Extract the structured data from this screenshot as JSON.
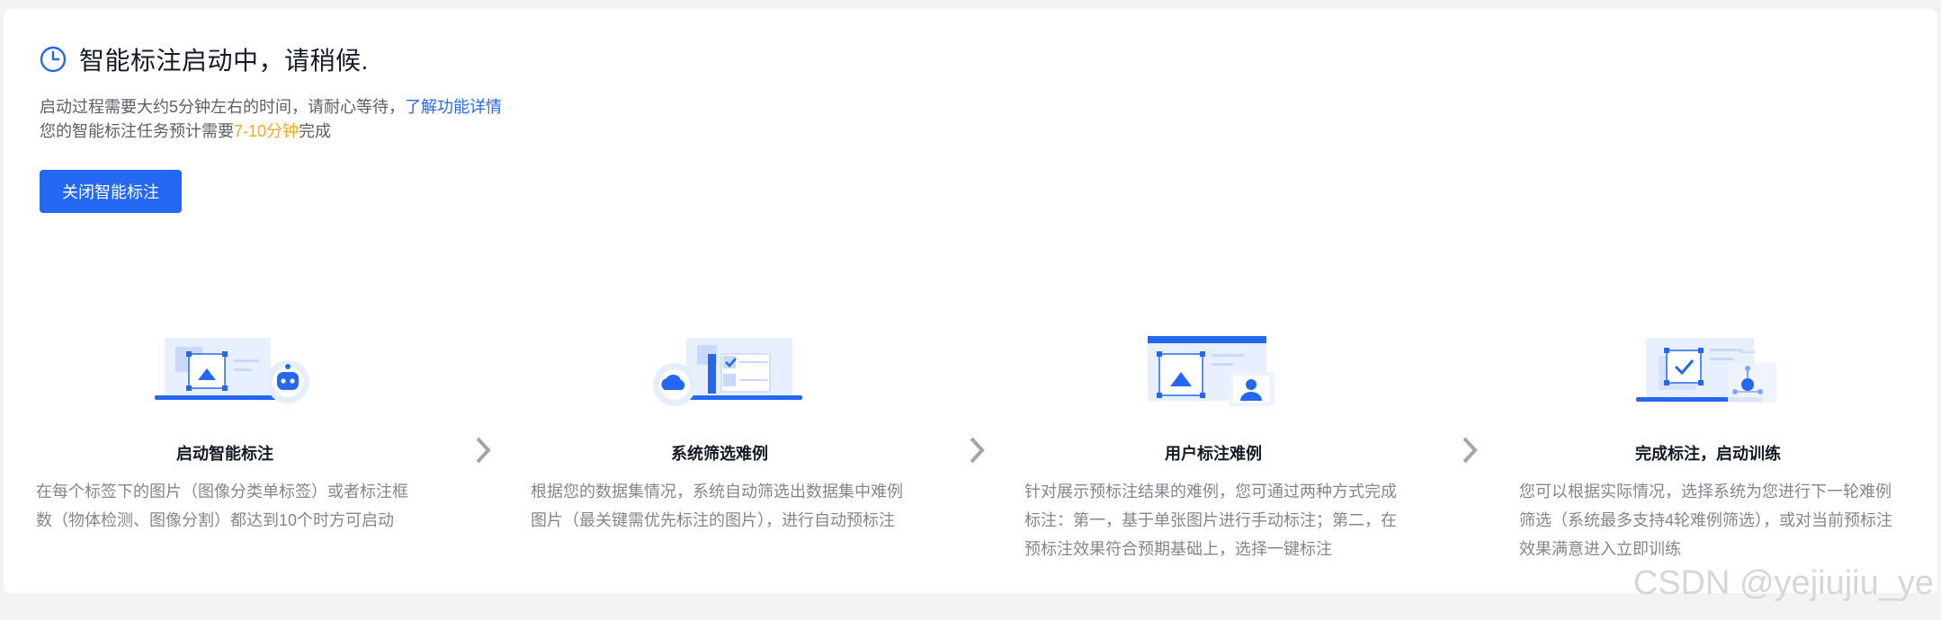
{
  "header": {
    "title": "智能标注启动中，请稍候.",
    "line1_text": "启动过程需要大约5分钟左右的时间，请耐心等待，",
    "line1_link": "了解功能详情",
    "line2_prefix": "您的智能标注任务预计需要",
    "line2_highlight": "7-10分钟",
    "line2_suffix": "完成"
  },
  "actions": {
    "close_label": "关闭智能标注"
  },
  "steps": [
    {
      "title": "启动智能标注",
      "desc": "在每个标签下的图片（图像分类单标签）或者标注框数（物体检测、图像分割）都达到10个时方可启动",
      "icon": "robot-icon"
    },
    {
      "title": "系统筛选难例",
      "desc": "根据您的数据集情况，系统自动筛选出数据集中难例图片（最关键需优先标注的图片），进行自动预标注",
      "icon": "cloud-icon"
    },
    {
      "title": "用户标注难例",
      "desc": "针对展示预标注结果的难例，您可通过两种方式完成标注：第一，基于单张图片进行手动标注；第二，在预标注效果符合预期基础上，选择一键标注",
      "icon": "user-icon"
    },
    {
      "title": "完成标注，启动训练",
      "desc": "您可以根据实际情况，选择系统为您进行下一轮难例筛选（系统最多支持4轮难例筛选），或对当前预标注效果满意进入立即训练",
      "icon": "training-icon"
    }
  ],
  "watermark": "CSDN @yejiujiu_ye",
  "colors": {
    "primary": "#2468f2",
    "highlight": "#f5a623",
    "muted": "#84868c"
  }
}
